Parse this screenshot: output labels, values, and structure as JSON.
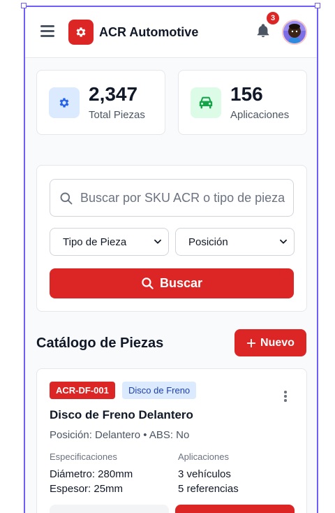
{
  "header": {
    "brand": "ACR Automotive",
    "notification_count": "3"
  },
  "stats": [
    {
      "value": "2,347",
      "label": "Total Piezas",
      "icon": "gear-icon",
      "color": "#2563eb",
      "bg": "#dbeafe"
    },
    {
      "value": "156",
      "label": "Aplicaciones",
      "icon": "car-icon",
      "color": "#16a34a",
      "bg": "#dcfce7"
    }
  ],
  "search": {
    "placeholder": "Buscar por SKU ACR o tipo de pieza",
    "part_type_select": "Tipo de Pieza",
    "position_select": "Posición",
    "button_label": "Buscar"
  },
  "catalog": {
    "title": "Catálogo de Piezas",
    "new_button": "Nuevo"
  },
  "part": {
    "sku": "ACR-DF-001",
    "type": "Disco de Freno",
    "name": "Disco de Freno Delantero",
    "meta": "Posición: Delantero • ABS: No",
    "specs_heading": "Especificaciones",
    "specs": [
      "Diámetro: 280mm",
      "Espesor: 25mm"
    ],
    "apps_heading": "Aplicaciones",
    "apps": [
      "3 vehículos",
      "5 referencias"
    ]
  },
  "colors": {
    "accent": "#dc2626",
    "frame": "#6d5dfc"
  }
}
